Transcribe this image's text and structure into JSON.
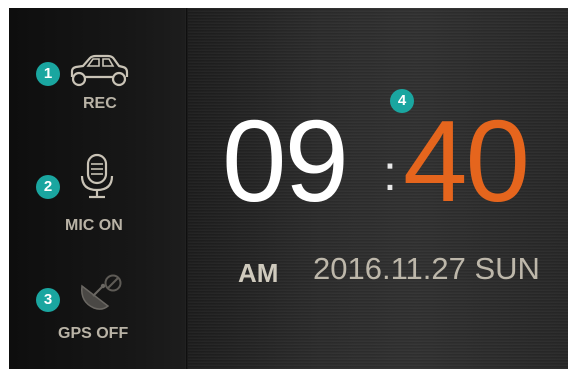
{
  "colors": {
    "badge": "#1aa6a0",
    "hours": "#ffffff",
    "minutes": "#e5651d",
    "label": "#b9b3a6"
  },
  "status": {
    "rec": {
      "label": "REC",
      "icon": "car-icon",
      "badge": "1"
    },
    "mic": {
      "label": "MIC ON",
      "icon": "microphone-icon",
      "badge": "2"
    },
    "gps": {
      "label": "GPS OFF",
      "icon": "satellite-dish-off-icon",
      "badge": "3"
    }
  },
  "clock": {
    "badge": "4",
    "hours": "09",
    "separator": ":",
    "minutes": "40",
    "ampm": "AM",
    "date": "2016.11.27 SUN"
  }
}
